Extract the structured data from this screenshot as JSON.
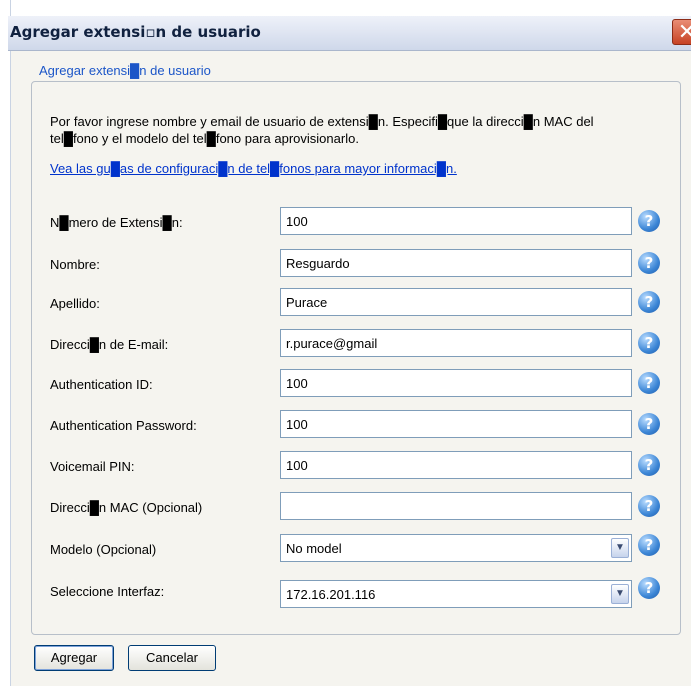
{
  "dialog": {
    "title": "Agregar extensi▫n de usuario",
    "close_glyph": "✕"
  },
  "form": {
    "legend": "Agregar extensi█n de usuario",
    "intro": "Por favor ingrese nombre y email de usuario de extensi█n. Especifi█que la direcci█n MAC del tel█fono y el modelo del tel█fono para aprovisionarlo.",
    "link": "Vea las gu█as de configuraci█n de tel█fonos para mayor informaci█n.",
    "help_glyph": "?",
    "fields": [
      {
        "label": "N█mero de Extensi█n:",
        "value": "100"
      },
      {
        "label": "Nombre:",
        "value": "Resguardo"
      },
      {
        "label": "Apellido:",
        "value": "Purace"
      },
      {
        "label": "Direcci█n de E-mail:",
        "value": "r.purace@gmail"
      },
      {
        "label": "Authentication ID:",
        "value": "100"
      },
      {
        "label": "Authentication Password:",
        "value": "100"
      },
      {
        "label": "Voicemail PIN:",
        "value": "100"
      },
      {
        "label": "Direcci█n MAC (Opcional)",
        "value": ""
      }
    ],
    "selects": [
      {
        "label": "Modelo (Opcional)",
        "value": "No model"
      },
      {
        "label": "Seleccione Interfaz:",
        "value": "172.16.201.116"
      }
    ]
  },
  "buttons": {
    "add": "Agregar",
    "cancel": "Cancelar"
  },
  "colors": {
    "legend": "#1c56c8",
    "link": "#0033cc",
    "close": "#c74224",
    "help": "#3c86d6"
  }
}
